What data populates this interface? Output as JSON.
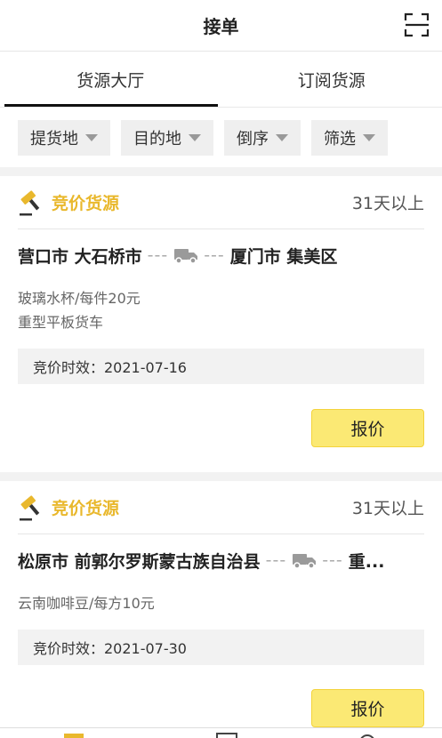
{
  "header": {
    "title": "接单",
    "scan_icon": "scan-icon"
  },
  "tabs": [
    {
      "label": "货源大厅",
      "active": true
    },
    {
      "label": "订阅货源",
      "active": false
    }
  ],
  "filters": [
    {
      "label": "提货地"
    },
    {
      "label": "目的地"
    },
    {
      "label": "倒序"
    },
    {
      "label": "筛选"
    }
  ],
  "cards": [
    {
      "badge": "竞价货源",
      "time": "31天以上",
      "origin": "营口市 大石桥市",
      "dash": "---",
      "destination": "厦门市 集美区",
      "desc1": "玻璃水杯/每件20元",
      "desc2": "重型平板货车",
      "validity": "竞价时效：2021-07-16",
      "button": "报价"
    },
    {
      "badge": "竞价货源",
      "time": "31天以上",
      "origin": "松原市 前郭尔罗斯蒙古族自治县",
      "dash": "---",
      "destination": "重...",
      "desc1": "云南咖啡豆/每方10元",
      "validity": "竞价时效：2021-07-30",
      "button": "报价"
    }
  ],
  "colors": {
    "accent": "#e9b82d",
    "button_bg": "#fbe974"
  }
}
